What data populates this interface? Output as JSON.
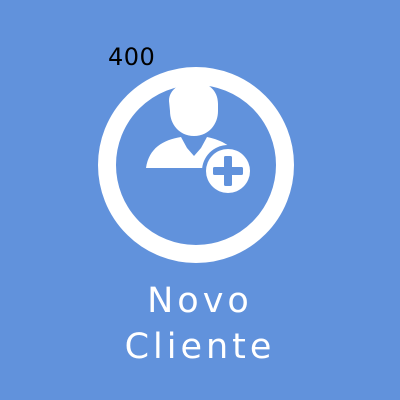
{
  "tile": {
    "badge_value": "400",
    "title_line_1": "Novo",
    "title_line_2": "Cliente",
    "icon": "add-user-icon"
  },
  "colors": {
    "background": "#6192dc",
    "foreground": "#ffffff",
    "badge_text": "#000000"
  }
}
